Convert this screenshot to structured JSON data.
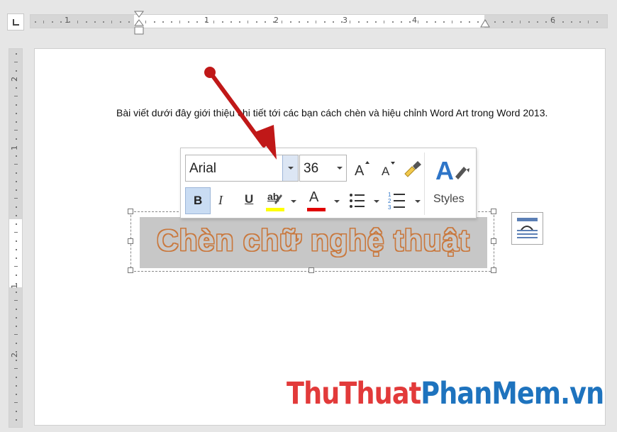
{
  "ruler": {
    "horizontal_marks": [
      "1",
      "1",
      "2",
      "3",
      "4",
      "6"
    ],
    "vertical_marks": [
      "2",
      "1",
      "1",
      "2"
    ]
  },
  "document": {
    "paragraph": "Bài viết dưới đây giới thiệu chi tiết tới các bạn cách chèn và hiệu chỉnh Word Art trong Word 2013.",
    "wordart_text": "Chèn chữ nghệ thuật"
  },
  "mini_toolbar": {
    "font_name": "Arial",
    "font_size": "36",
    "bold_label": "B",
    "italic_label": "I",
    "underline_label": "U",
    "highlight_label": "ab",
    "font_color_label": "A",
    "styles_label": "Styles",
    "highlight_color": "#ffff00",
    "font_color": "#e00000"
  },
  "watermark": {
    "part1": "ThuThuat",
    "part2": "PhanMem.vn",
    "color1": "#e23a3a",
    "color2": "#1e73be"
  },
  "colors": {
    "wordart_outline": "#c9783d",
    "wordart_fill": "#c9c9c9",
    "arrow": "#c01818"
  }
}
